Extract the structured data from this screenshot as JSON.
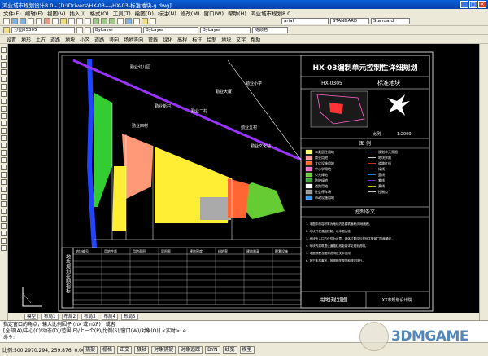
{
  "window": {
    "title": "鸿业城市规划设计8.0 - [D:\\Drivers\\HX-03---\\HX-03-标准地块-g.dwg]"
  },
  "menu": [
    "文件(F)",
    "编辑(E)",
    "视图(V)",
    "插入(I)",
    "格式(O)",
    "工具(T)",
    "绘图(D)",
    "标注(N)",
    "修改(M)",
    "窗口(W)",
    "帮助(H)",
    "鸿业城市规划8.0"
  ],
  "toolbar": {
    "font_style": "arial",
    "dim_style": "STANDARD",
    "text_style": "Standard",
    "layer": "分图05305",
    "color": "ByLayer",
    "linetype": "ByLayer",
    "lineweight": "ByLayer",
    "plot_style": "随颜色"
  },
  "cn_menu": [
    "设置",
    "地形",
    "土方",
    "道路",
    "地块",
    "小区",
    "道路",
    "竖向",
    "场地竖向",
    "管线",
    "绿化",
    "高程",
    "标注",
    "绘制",
    "地块",
    "文字",
    "帮助"
  ],
  "drawing": {
    "title": "HX-03编制单元控制性详细规划",
    "block_code": "HX-0305",
    "block_label": "标准地块",
    "scale_label": "比例",
    "scale_value": "1:2000",
    "legend_title": "图 例",
    "legend": [
      {
        "label": "二类居住用地",
        "color": "#ffff66"
      },
      {
        "label": "商业用地",
        "color": "#ff9999"
      },
      {
        "label": "文化设施用地",
        "color": "#ff6633"
      },
      {
        "label": "中小学用地",
        "color": "#ff66cc"
      },
      {
        "label": "公共绿地",
        "color": "#66cc33"
      },
      {
        "label": "防护绿地",
        "color": "#33aa33"
      },
      {
        "label": "道路用地",
        "color": "#ffffff"
      },
      {
        "label": "社会停车场",
        "color": "#999999"
      },
      {
        "label": "市政设施用地",
        "color": "#3399ff"
      }
    ],
    "legend_right": [
      "规划单元界限",
      "地块界限",
      "道路红线",
      "绿线",
      "蓝线",
      "紫线",
      "黄线",
      "控制点"
    ],
    "control_title": "控制条文",
    "control_text": [
      "1. 本图中的容积率为地块内总建筑面积/用地面积。",
      "2. 地块开发强度控制，以本图为准。",
      "3. 地块出入口方位仅为示意，具体位置应与规划主管部门协商确定。",
      "4. 地块内建筑退让道路红线距离详见规划说明。",
      "5. 本图须配合图则说明及文本使用。",
      "6. 其它未尽事宜，按照相关规范和规定执行。"
    ],
    "footer_title": "用地规划图",
    "footer_org": "XX市规划设计院",
    "side_label": "地块规划控制指标",
    "map_labels": [
      "勤业小学",
      "勤业幼儿园",
      "勤业新村",
      "勤业四村",
      "勤业二村",
      "勤业大厦",
      "勤业文化站",
      "勤业五村"
    ],
    "table_header": [
      "地块编号",
      "用地性质",
      "用地面积",
      "容积率",
      "建筑密度",
      "绿地率",
      "建筑限高",
      "配套设施"
    ]
  },
  "tabs": [
    "模型",
    "布局1",
    "布局2",
    "布局3",
    "布局4",
    "布局5"
  ],
  "command": {
    "line1": "指定窗口的角点，输入比例因子 (nX 或 nXP)，或者",
    "line2": "[全部(A)/中心(C)/动态(D)/范围(E)/上一个(P)/比例(S)/窗口(W)/对象(O)] <实时>: e",
    "line3": "命令:"
  },
  "status": {
    "coords": "比例:500 2970.294, 259.876, 0.000",
    "buttons": [
      "捕捉",
      "栅格",
      "正交",
      "极轴",
      "对象捕捉",
      "对象追踪",
      "DYN",
      "线宽",
      "模型"
    ]
  },
  "watermark": "3DMGAME"
}
